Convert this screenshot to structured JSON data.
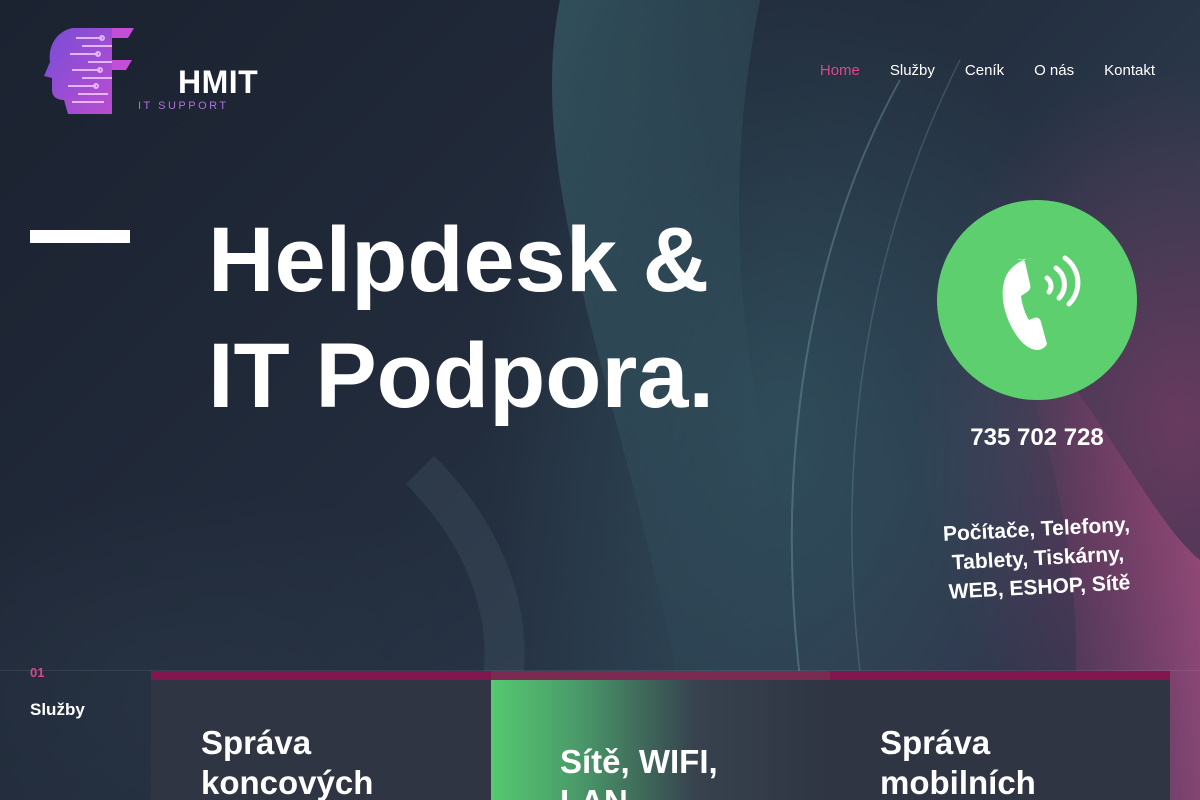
{
  "brand": {
    "name": "HMIT",
    "subtitle": "IT SUPPORT",
    "accent": "#b36de0"
  },
  "nav": {
    "items": [
      {
        "label": "Home",
        "active": true
      },
      {
        "label": "Služby",
        "active": false
      },
      {
        "label": "Ceník",
        "active": false
      },
      {
        "label": "O nás",
        "active": false
      },
      {
        "label": "Kontakt",
        "active": false
      }
    ],
    "active_color": "#d9478f"
  },
  "hero": {
    "title_line1": "Helpdesk &",
    "title_line2": "IT Podpora."
  },
  "contact": {
    "icon": "phone-ringing-icon",
    "circle_color": "#5dcf6f",
    "phone": "735 702 728",
    "tags_line1": "Počítače, Telefony,",
    "tags_line2": "Tablety, Tiskárny,",
    "tags_line3": "WEB, ESHOP, Sítě"
  },
  "services": {
    "number": "01",
    "label": "Služby",
    "cards": [
      {
        "line1": "Správa",
        "line2": "koncových"
      },
      {
        "line1": "Sítě, WIFI,",
        "line2": "LAN"
      },
      {
        "line1": "Správa",
        "line2": "mobilních"
      }
    ]
  }
}
